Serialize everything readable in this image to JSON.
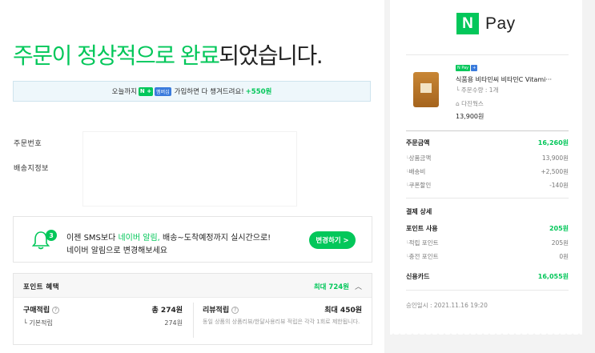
{
  "title": {
    "part1": "주문이 정상적으로 완료",
    "part2": "되었습니다."
  },
  "promo": {
    "pre": "오늘까지",
    "n_badge": "N +",
    "m_badge": "멤버십",
    "mid": "가입하면 다 챙겨드려요!",
    "points": "+550원"
  },
  "order": {
    "order_no_label": "주문번호",
    "shipping_label": "배송지정보"
  },
  "alert": {
    "badge": "3",
    "line1_pre": "이젠 SMS보다 ",
    "line1_green": "네이버 알림,",
    "line1_post": " 배송~도착예정까지 실시간으로!",
    "line2": "네이버 알림으로 변경해보세요",
    "button": "변경하기 >"
  },
  "points": {
    "header": "포인트 혜택",
    "max": "최대 724원",
    "purchase_label": "구매적립",
    "purchase_total": "총 274원",
    "basic_label": "기본적립",
    "basic_value": "274원",
    "review_label": "리뷰적립",
    "review_max": "최대 450원",
    "review_note": "동일 상품의 상품리뷰/한달사용리뷰 적립은 각각 1회로 제한됩니다."
  },
  "npay": {
    "logo": "N",
    "text": "Pay"
  },
  "product": {
    "tag_n": "N Pay",
    "tag_plus": "+",
    "name": "식품용 비타민씨 비타민C Vitami···",
    "qty": "주문수량 : 1개",
    "store": "다진웍스",
    "price": "13,900원"
  },
  "summary": {
    "order_amount_label": "주문금액",
    "order_amount": "16,260원",
    "product_amount_label": "상품금액",
    "product_amount": "13,900원",
    "shipping_label": "배송비",
    "shipping": "+2,500원",
    "coupon_label": "쿠폰할인",
    "coupon": "-140원",
    "payment_label": "결제 상세",
    "point_use_label": "포인트 사용",
    "point_use": "205원",
    "earned_point_label": "적립 포인트",
    "earned_point": "205원",
    "charge_point_label": "충전 포인트",
    "charge_point": "0원",
    "card_label": "신용카드",
    "card": "16,055원",
    "approved": "승인일시 : 2021.11.16 19:20"
  }
}
